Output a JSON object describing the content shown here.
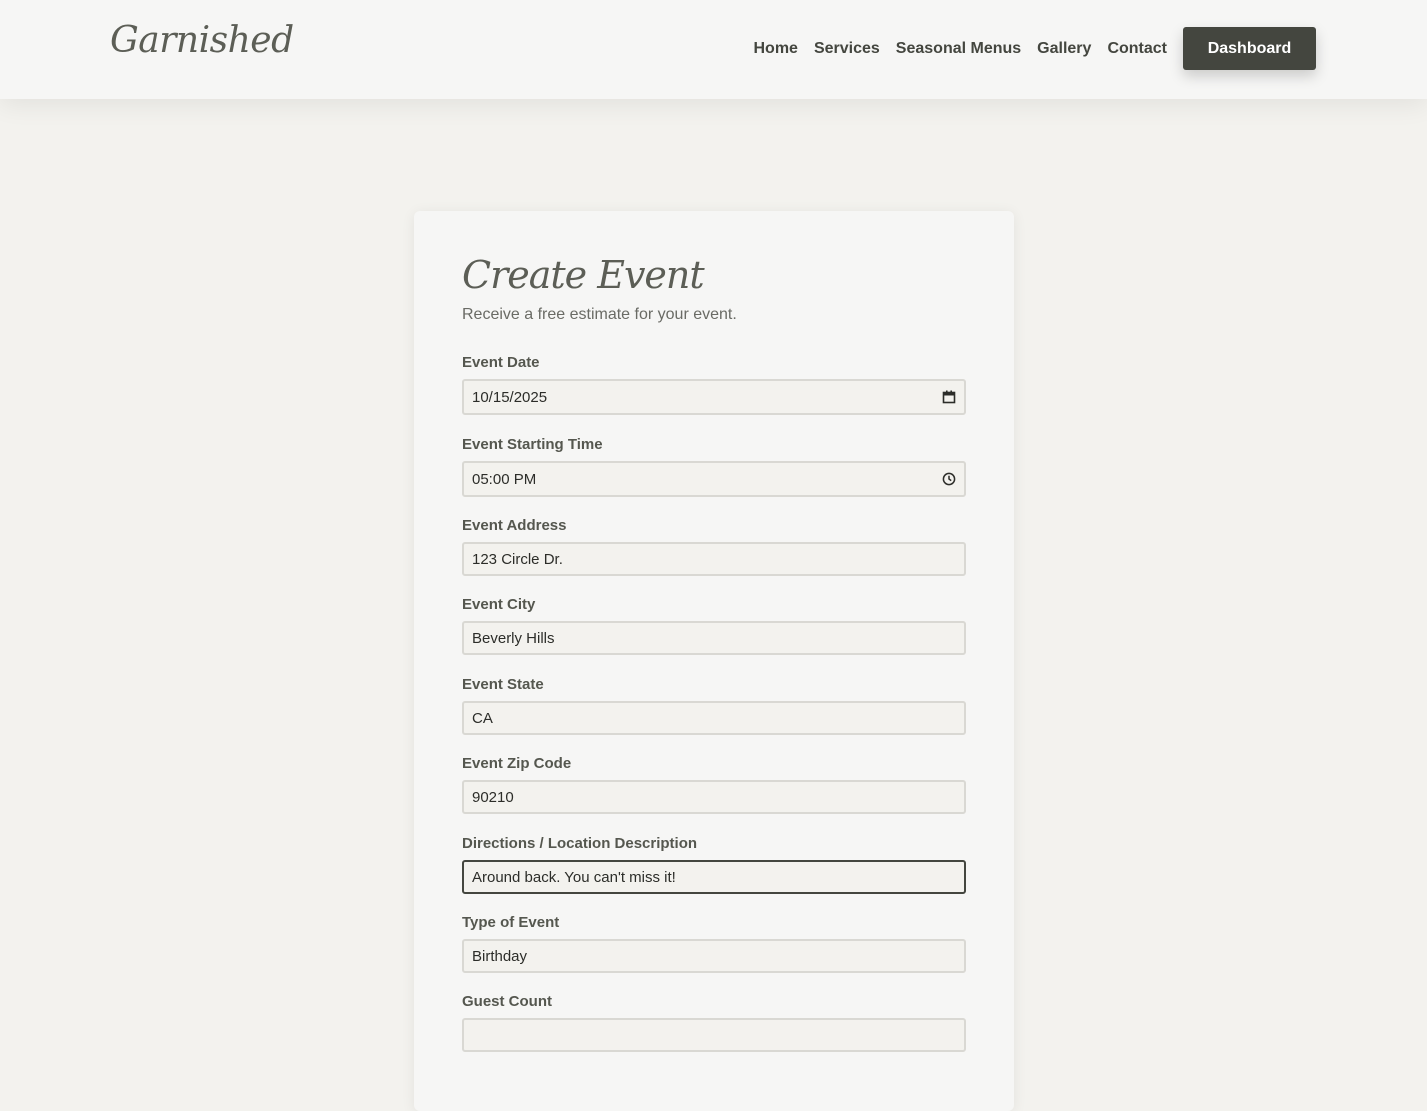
{
  "header": {
    "logo": "Garnished",
    "nav": [
      "Home",
      "Services",
      "Seasonal Menus",
      "Gallery",
      "Contact"
    ],
    "dashboard_label": "Dashboard"
  },
  "form": {
    "title": "Create Event",
    "subtitle": "Receive a free estimate for your event.",
    "fields": [
      {
        "label": "Event Date",
        "value": "10/15/2025",
        "icon": "calendar-icon"
      },
      {
        "label": "Event Starting Time",
        "value": "05:00 PM",
        "icon": "clock-icon"
      },
      {
        "label": "Event Address",
        "value": "123 Circle Dr."
      },
      {
        "label": "Event City",
        "value": "Beverly Hills"
      },
      {
        "label": "Event State",
        "value": "CA"
      },
      {
        "label": "Event Zip Code",
        "value": "90210"
      },
      {
        "label": "Directions / Location Description",
        "value": "Around back. You can't miss it!"
      },
      {
        "label": "Type of Event",
        "value": "Birthday"
      },
      {
        "label": "Guest Count",
        "value": ""
      }
    ]
  },
  "colors": {
    "page_bg": "#f3f2ee",
    "card_bg": "#f6f6f5",
    "primary": "#44463f",
    "input_border": "#d9d8d3"
  }
}
